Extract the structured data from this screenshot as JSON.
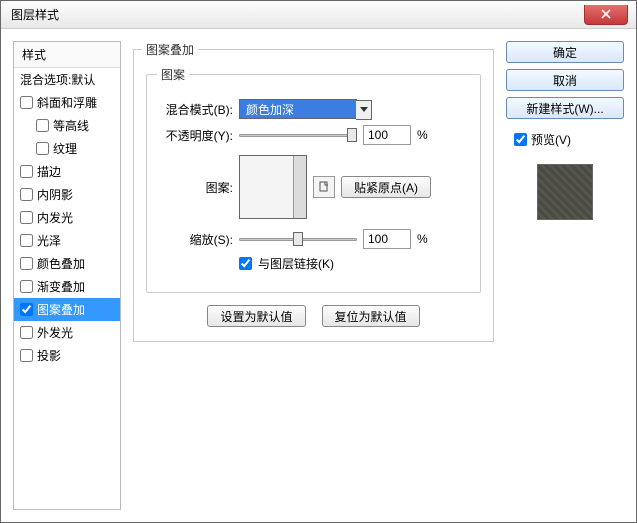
{
  "window": {
    "title": "图层样式"
  },
  "sidebar": {
    "header": "样式",
    "items": [
      {
        "label": "混合选项:默认",
        "checked": null
      },
      {
        "label": "斜面和浮雕",
        "checked": false
      },
      {
        "label": "等高线",
        "checked": false,
        "indent": true
      },
      {
        "label": "纹理",
        "checked": false,
        "indent": true
      },
      {
        "label": "描边",
        "checked": false
      },
      {
        "label": "内阴影",
        "checked": false
      },
      {
        "label": "内发光",
        "checked": false
      },
      {
        "label": "光泽",
        "checked": false
      },
      {
        "label": "颜色叠加",
        "checked": false
      },
      {
        "label": "渐变叠加",
        "checked": false
      },
      {
        "label": "图案叠加",
        "checked": true,
        "selected": true
      },
      {
        "label": "外发光",
        "checked": false
      },
      {
        "label": "投影",
        "checked": false
      }
    ]
  },
  "main": {
    "outer_legend": "图案叠加",
    "inner_legend": "图案",
    "blend_mode": {
      "label": "混合模式(B):",
      "value": "颜色加深"
    },
    "opacity": {
      "label": "不透明度(Y):",
      "value": "100",
      "unit": "%"
    },
    "pattern": {
      "label": "图案:",
      "snap_button": "贴紧原点(A)"
    },
    "scale": {
      "label": "缩放(S):",
      "value": "100",
      "unit": "%"
    },
    "link": {
      "label": "与图层链接(K)",
      "checked": true
    },
    "defaults": {
      "set": "设置为默认值",
      "reset": "复位为默认值"
    }
  },
  "right": {
    "ok": "确定",
    "cancel": "取消",
    "new_style": "新建样式(W)...",
    "preview_label": "预览(V)",
    "preview_checked": true
  }
}
